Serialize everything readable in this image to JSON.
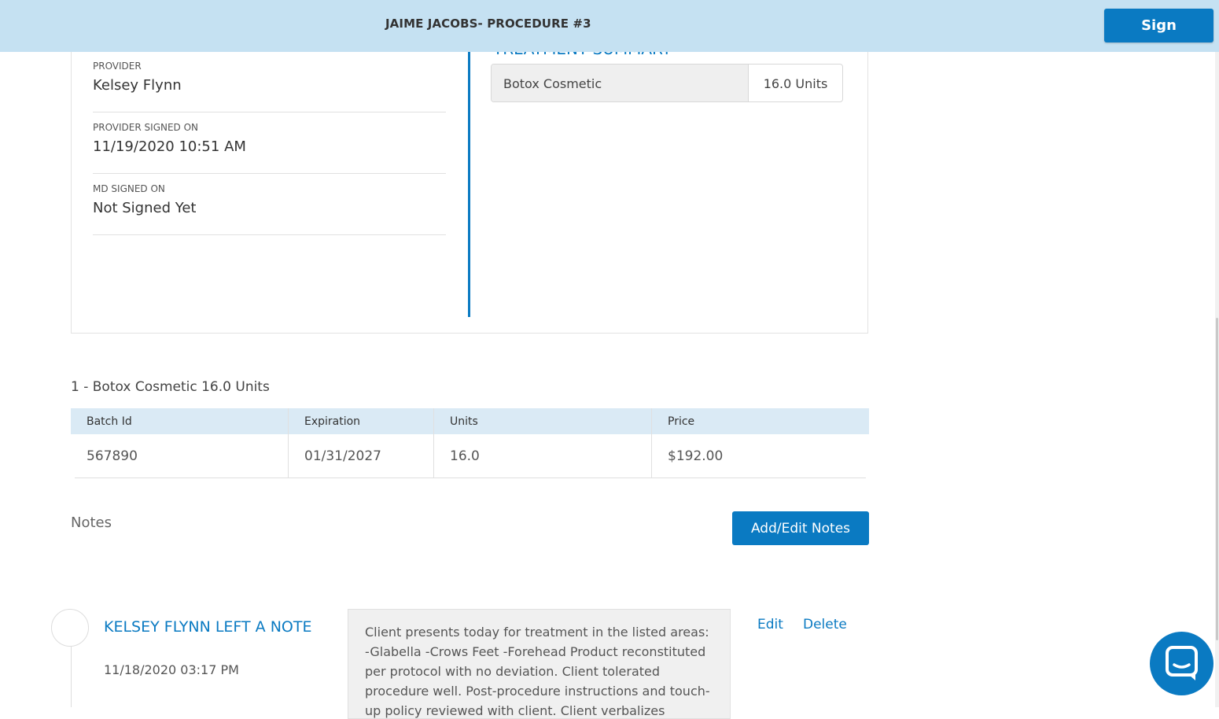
{
  "header": {
    "title": "JAIME JACOBS- PROCEDURE #3",
    "sign_label": "Sign"
  },
  "summary": {
    "items": [
      {
        "label": "PROVIDER",
        "value": "Kelsey Flynn"
      },
      {
        "label": "PROVIDER SIGNED ON",
        "value": "11/19/2020 10:51 AM"
      },
      {
        "label": "MD SIGNED ON",
        "value": "Not Signed Yet"
      }
    ],
    "treatment_heading": "TREATMENT SUMMARY",
    "treatment": {
      "name": "Botox Cosmetic",
      "units": "16.0 Units"
    }
  },
  "product": {
    "title": "1 - Botox Cosmetic 16.0 Units",
    "columns": [
      "Batch Id",
      "Expiration",
      "Units",
      "Price"
    ],
    "rows": [
      [
        "567890",
        "01/31/2027",
        "16.0",
        "$192.00"
      ]
    ]
  },
  "notes": {
    "label": "Notes",
    "add_button": "Add/Edit Notes",
    "entries": [
      {
        "author": "KELSEY FLYNN LEFT A NOTE",
        "date": "11/18/2020 03:17 PM",
        "text": "Client presents today for treatment in the listed areas: -Glabella -Crows Feet -Forehead Product reconstituted per protocol with no deviation. Client tolerated procedure well. Post-procedure instructions and touch-up policy reviewed with client. Client verbalizes understanding.",
        "edit_label": "Edit",
        "delete_label": "Delete"
      }
    ]
  },
  "icons": {
    "avatar": "avatar-placeholder",
    "chat": "chat-bubble-icon"
  },
  "colors": {
    "accent": "#0a7ac2",
    "header_bg": "#c5e1f2",
    "table_header_bg": "#daeaf5"
  }
}
